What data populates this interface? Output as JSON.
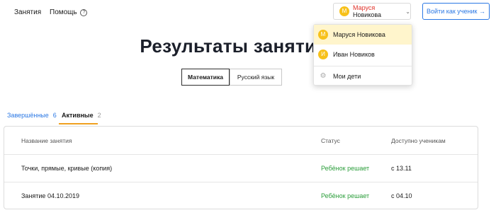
{
  "nav": {
    "lessons": "Занятия",
    "help": "Помощь",
    "help_icon": "?"
  },
  "user_select": {
    "avatar_letter": "М",
    "first_name": "Маруся",
    "last_name": "Новикова",
    "chevron": "⌄"
  },
  "login_button": "Войти как ученик →",
  "page_title": "Результаты занятий",
  "subjects": [
    {
      "label": "Математика",
      "active": true
    },
    {
      "label": "Русский язык",
      "active": false
    }
  ],
  "status_tabs": [
    {
      "label": "Завершённые",
      "count": "6",
      "active": false
    },
    {
      "label": "Активные",
      "count": "2",
      "active": true
    }
  ],
  "table": {
    "headers": {
      "name": "Название занятия",
      "status": "Статус",
      "available": "Доступно ученикам"
    },
    "rows": [
      {
        "name": "Точки, прямые, кривые (копия)",
        "status": "Ребёнок решает",
        "available": "с 13.11"
      },
      {
        "name": "Занятие 04.10.2019",
        "status": "Ребёнок решает",
        "available": "с 04.10"
      }
    ]
  },
  "dropdown": {
    "items": [
      {
        "avatar_letter": "М",
        "label": "Маруся Новикова",
        "selected": true
      },
      {
        "avatar_letter": "И",
        "label": "Иван Новиков",
        "selected": false
      }
    ],
    "my_children": "Мои дети",
    "my_children_icon": "gear-icon"
  },
  "colors": {
    "accent_blue": "#2b78e4",
    "status_green": "#2a9d3a",
    "avatar_yellow": "#f7c11a",
    "tab_underline": "#f0a020",
    "selected_bg": "#fff5cc"
  }
}
